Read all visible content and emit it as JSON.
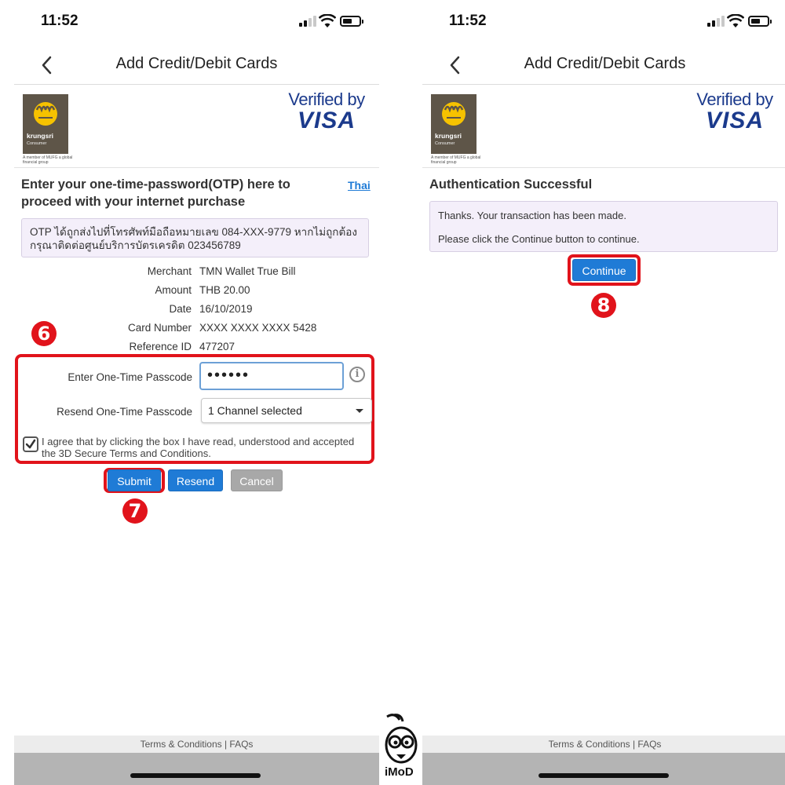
{
  "status_bar": {
    "time": "11:52"
  },
  "left_screen": {
    "title": "Add Credit/Debit Cards",
    "bank_logo": {
      "brand": "krungsri",
      "sub": "Consumer",
      "member": "A member of MUFG a global financial group"
    },
    "verified": {
      "line1": "Verified by",
      "line2": "VISA"
    },
    "heading": "Enter your one-time-password(OTP) here to proceed with your internet purchase",
    "language_link": "Thai",
    "notice": "OTP ได้ถูกส่งไปที่โทรศัพท์มือถือหมายเลข 084-XXX-9779 หากไม่ถูกต้อง กรุณาติดต่อศูนย์บริการบัตรเครดิต 023456789",
    "details": [
      {
        "label": "Merchant",
        "value": "TMN Wallet True Bill"
      },
      {
        "label": "Amount",
        "value": "THB 20.00"
      },
      {
        "label": "Date",
        "value": "16/10/2019"
      },
      {
        "label": "Card Number",
        "value": "XXXX XXXX XXXX 5428"
      },
      {
        "label": "Reference ID",
        "value": "477207"
      }
    ],
    "otp_label": "Enter One-Time Passcode",
    "otp_value": "••••••",
    "resend_label": "Resend One-Time Passcode",
    "resend_selected": "1 Channel selected",
    "agree_text": "I agree that by clicking the box I have read, understood and accepted the 3D Secure Terms and Conditions.",
    "buttons": {
      "submit": "Submit",
      "resend": "Resend",
      "cancel": "Cancel"
    },
    "footer": "Terms & Conditions | FAQs"
  },
  "right_screen": {
    "title": "Add Credit/Debit Cards",
    "heading": "Authentication Successful",
    "message_line1": "Thanks. Your transaction has been made.",
    "message_line2": "Please click the Continue button to continue.",
    "continue_button": "Continue",
    "footer": "Terms & Conditions | FAQs"
  },
  "step_markers": {
    "step6": "6",
    "step7": "7",
    "step8": "8"
  },
  "watermark": "iMoD",
  "colors": {
    "highlight": "#e1131b",
    "primary_button": "#1f7bd6",
    "disabled_button": "#a8a8a8",
    "visa_blue": "#1b3a8c",
    "notice_bg": "#f4effa"
  },
  "icons": [
    "back-chevron-icon",
    "signal-icon",
    "wifi-icon",
    "battery-icon",
    "info-icon",
    "dropdown-caret-icon",
    "checkbox-checked-icon"
  ]
}
